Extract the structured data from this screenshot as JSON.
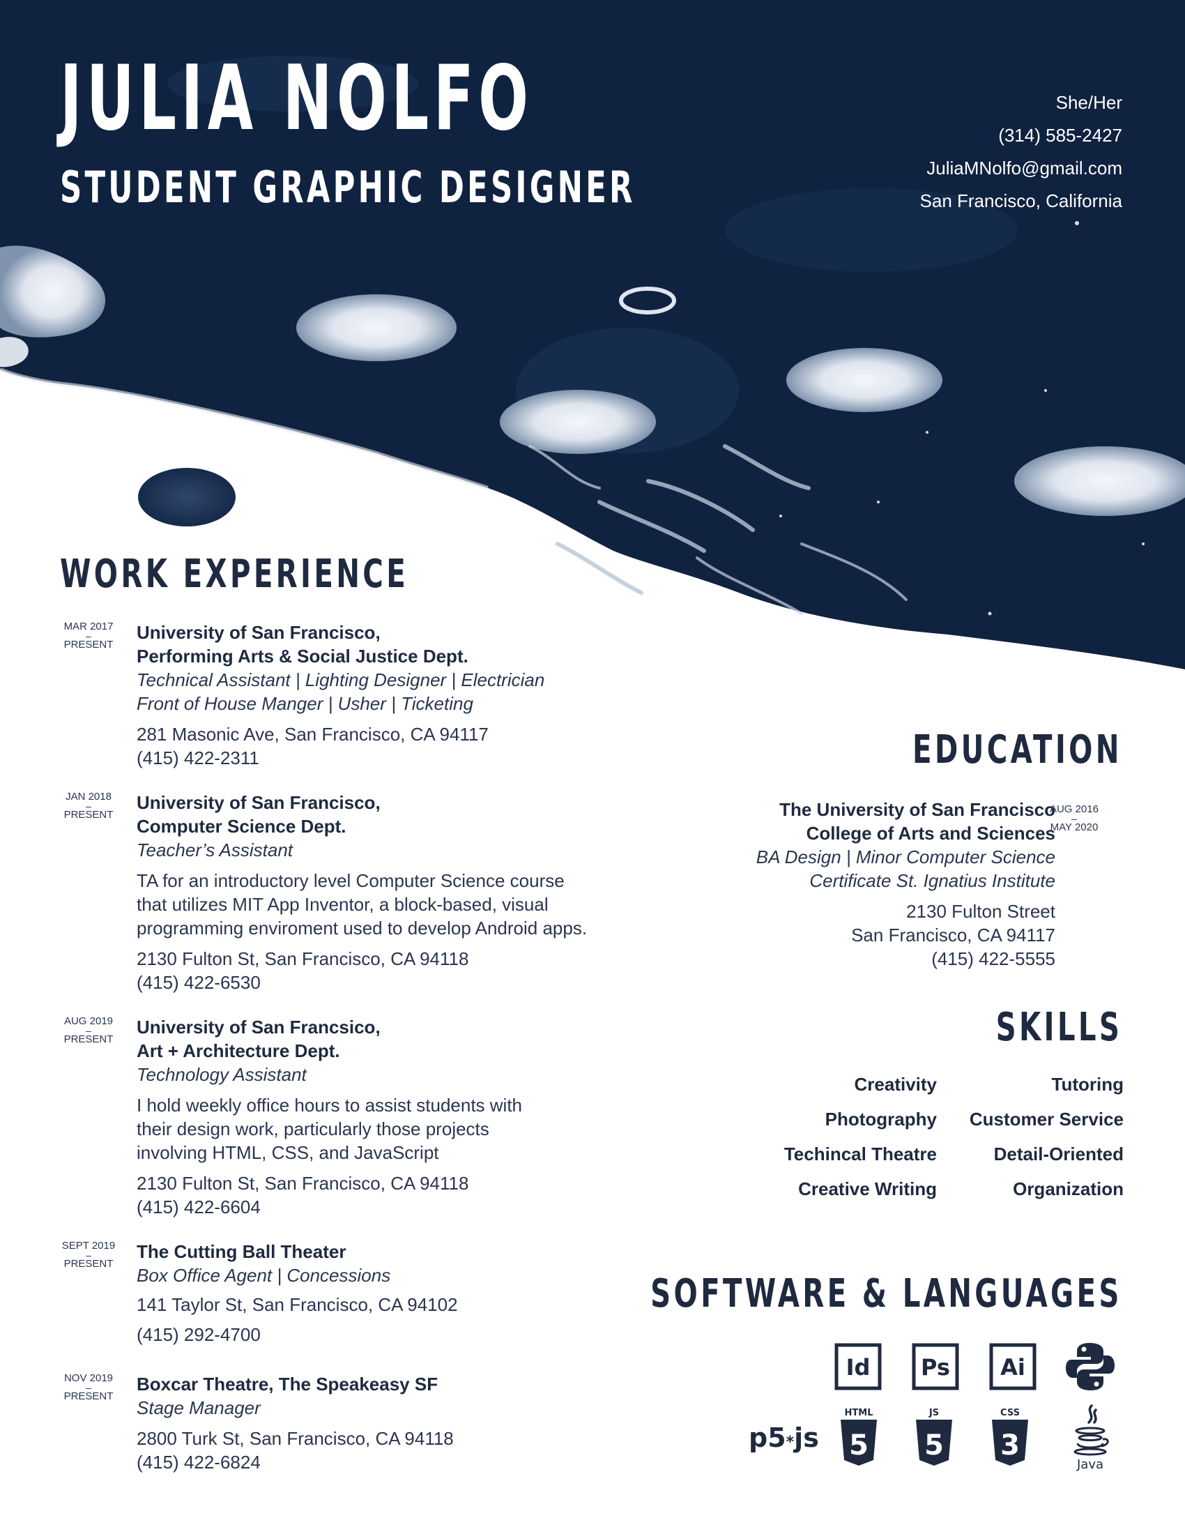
{
  "header": {
    "name": "JULIA NOLFO",
    "role": "STUDENT GRAPHIC DESIGNER",
    "pronouns": "She/Her",
    "phone": "(314) 585-2427",
    "email": "JuliaMNolfo@gmail.com",
    "location": "San Francisco, California"
  },
  "colors": {
    "navy": "#0f2240",
    "text": "#1f2a40",
    "white": "#ffffff"
  },
  "work": {
    "title": "WORK EXPERIENCE",
    "jobs": [
      {
        "start": "MAR 2017",
        "dash": "–",
        "end": "PRESENT",
        "org1": "University of San Francisco,",
        "org2": "Performing Arts & Social Justice Dept.",
        "role1": "Technical Assistant | Lighting Designer | Electrician",
        "role2": "Front of House Manger | Usher | Ticketing",
        "address": "281 Masonic Ave, San Francisco, CA 94117",
        "phone": "(415) 422-2311"
      },
      {
        "start": "JAN 2018",
        "dash": "–",
        "end": "PRESENT",
        "org1": "University of San Francisco,",
        "org2": "Computer Science Dept.",
        "role1": "Teacher’s Assistant",
        "desc1": "TA for an introductory level Computer Science course",
        "desc2": "that utilizes MIT App Inventor, a block-based, visual",
        "desc3": "programming enviroment used to develop Android apps.",
        "address": "2130 Fulton St, San Francisco, CA 94118",
        "phone": "(415) 422-6530"
      },
      {
        "start": "AUG 2019",
        "dash": "–",
        "end": "PRESENT",
        "org1": "University of San Francsico,",
        "org2": "Art + Architecture Dept.",
        "role1": "Technology Assistant",
        "desc1": "I hold weekly office hours to assist students with",
        "desc2": "their design work, particularly those projects",
        "desc3": "involving HTML, CSS, and JavaScript",
        "address": "2130 Fulton St, San Francisco, CA 94118",
        "phone": "(415) 422-6604"
      },
      {
        "start": "SEPT 2019",
        "dash": "–",
        "end": "PRESENT",
        "org1": "The Cutting Ball Theater",
        "role1": "Box Office Agent | Concessions",
        "address": "141 Taylor St, San Francisco, CA 94102",
        "phone": "(415) 292-4700"
      },
      {
        "start": "NOV 2019",
        "dash": "–",
        "end": "PRESENT",
        "org1": "Boxcar Theatre, The Speakeasy SF",
        "role1": "Stage Manager",
        "address": "2800 Turk St, San Francisco, CA 94118",
        "phone": "(415) 422-6824"
      }
    ]
  },
  "education": {
    "title": "EDUCATION",
    "school": "The University of San Francisco",
    "college": "College of Arts and Sciences",
    "degree": "BA Design | Minor Computer Science",
    "certificate": "Certificate St. Ignatius Institute",
    "street": "2130 Fulton Street",
    "city": "San Francisco, CA 94117",
    "phone": "(415) 422-5555",
    "start": "AUG 2016",
    "dash": "–",
    "end": "MAY 2020"
  },
  "skills": {
    "title": "SKILLS",
    "left": [
      "Creativity",
      "Photography",
      "Techincal Theatre",
      "Creative Writing"
    ],
    "right": [
      "Tutoring",
      "Customer Service",
      "Detail-Oriented",
      "Organization"
    ]
  },
  "software": {
    "title": "SOFTWARE & LANGUAGES",
    "indesign": "Id",
    "photoshop": "Ps",
    "illustrator": "Ai",
    "p5": "p5",
    "p5_suffix": "js",
    "html": "HTML",
    "js": "JS",
    "css": "CSS",
    "java": "Java",
    "icons": [
      "indesign-icon",
      "photoshop-icon",
      "illustrator-icon",
      "python-icon",
      "p5js-icon",
      "html5-icon",
      "javascript-icon",
      "css3-icon",
      "java-icon"
    ]
  }
}
